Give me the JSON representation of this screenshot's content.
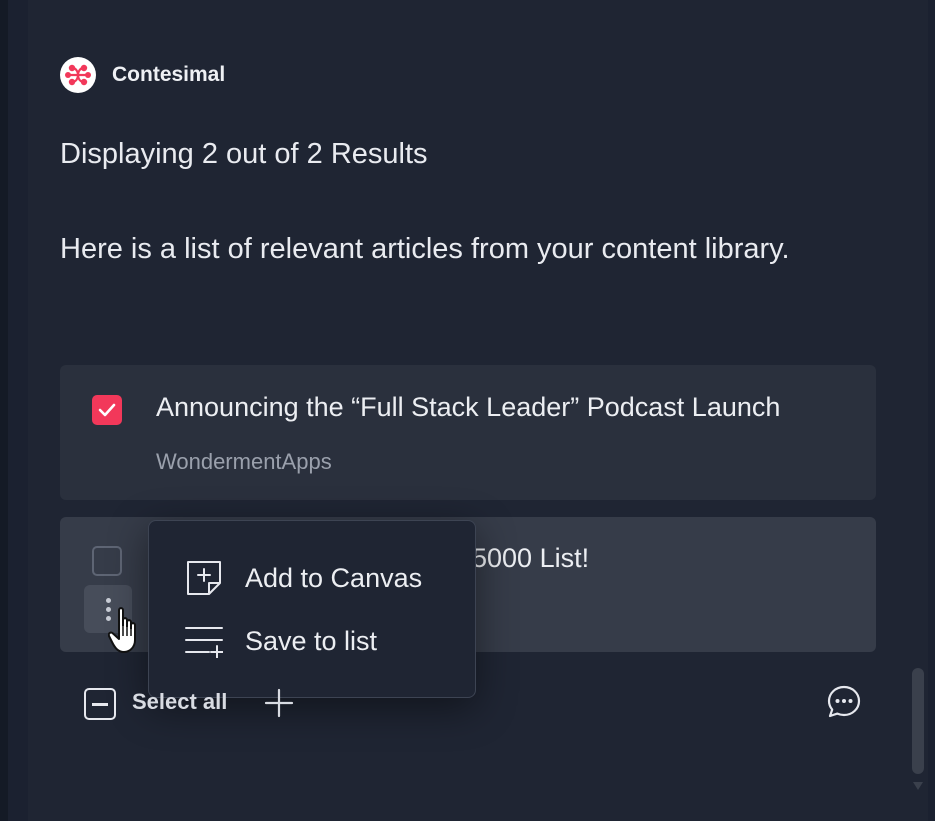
{
  "brand": {
    "name": "Contesimal",
    "logo_icon": "contesimal-logo-icon",
    "accent": "#f2385a"
  },
  "results": {
    "count_text": "Displaying 2 out of 2 Results"
  },
  "intro": {
    "text": "Here is a list of relevant articles from your content library."
  },
  "articles": [
    {
      "title": "Announcing the “Full Stack Leader” Podcast Launch",
      "source": "WondermentApps",
      "checked": true
    },
    {
      "title": "5000 List!",
      "checked": false
    }
  ],
  "context_menu": {
    "items": [
      {
        "label": "Add to Canvas",
        "icon": "add-note-icon"
      },
      {
        "label": "Save to list",
        "icon": "playlist-add-icon"
      }
    ]
  },
  "footer": {
    "select_all_label": "Select all",
    "add_icon": "plus-icon",
    "chat_icon": "chat-bubble-icon"
  }
}
